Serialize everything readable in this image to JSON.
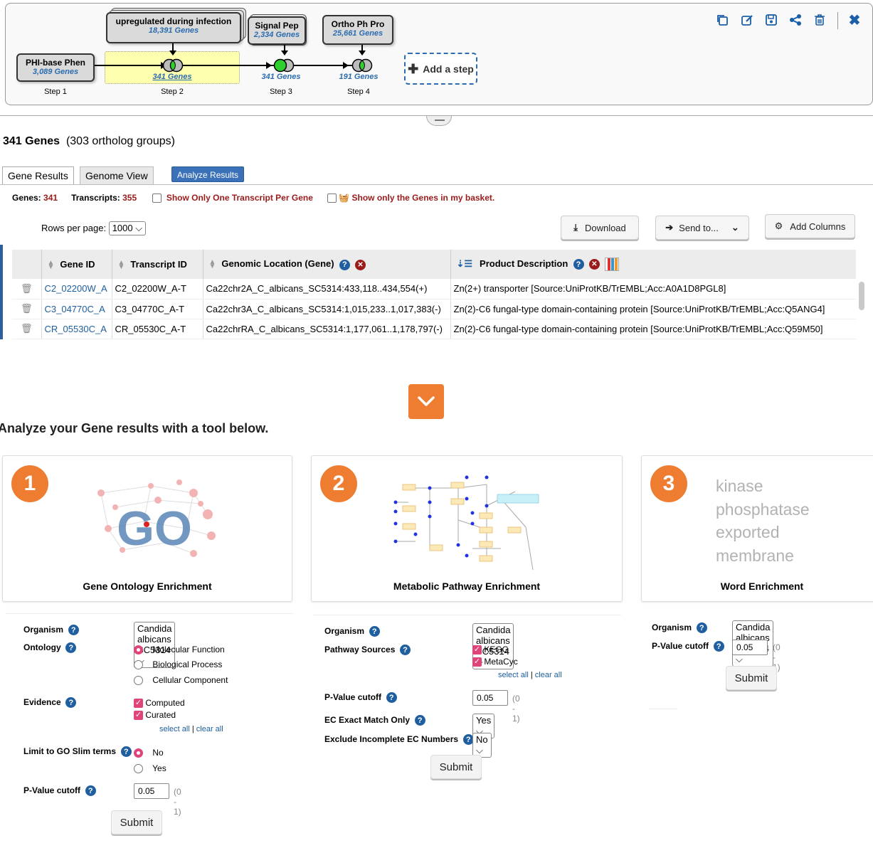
{
  "strategy": {
    "steps": [
      {
        "name": "PHI-base Phen",
        "count": "3,089 Genes",
        "label": "Step 1"
      },
      {
        "name": "upregulated during infection",
        "count": "18,391 Genes",
        "result": "341 Genes",
        "label": "Step 2"
      },
      {
        "name": "Signal Pep",
        "count": "2,334 Genes",
        "result": "341 Genes",
        "label": "Step 3"
      },
      {
        "name": "Ortho Ph Pro",
        "count": "25,661 Genes",
        "result": "191 Genes",
        "label": "Step 4"
      }
    ],
    "add_step": "Add a step",
    "toolbar": [
      "copy-icon",
      "edit-icon",
      "save-icon",
      "share-icon",
      "delete-icon",
      "close-icon"
    ]
  },
  "results": {
    "count": "341 Genes",
    "groups": "(303 ortholog groups)",
    "tabs": [
      "Gene Results",
      "Genome View",
      "Analyze Results"
    ],
    "genes_label": "Genes:",
    "genes_value": "341",
    "transcripts_label": "Transcripts:",
    "transcripts_value": "355",
    "one_transcript": "Show Only One Transcript Per Gene",
    "basket_only": "Show only the Genes in my basket.",
    "rows_label": "Rows per page:",
    "rows_value": "1000",
    "download": "Download",
    "send_to": "Send to...",
    "add_columns": "Add Columns",
    "columns": [
      "Gene ID",
      "Transcript ID",
      "Genomic Location (Gene)",
      "Product Description"
    ],
    "rows": [
      {
        "gene": "C2_02200W_A",
        "transcript": "C2_02200W_A-T",
        "location": "Ca22chr2A_C_albicans_SC5314:433,118..434,554(+)",
        "product": "Zn(2+) transporter [Source:UniProtKB/TrEMBL;Acc:A0A1D8PGL8]"
      },
      {
        "gene": "C3_04770C_A",
        "transcript": "C3_04770C_A-T",
        "location": "Ca22chr3A_C_albicans_SC5314:1,015,233..1,017,383(-)",
        "product": "Zn(2)-C6 fungal-type domain-containing protein [Source:UniProtKB/TrEMBL;Acc:Q5ANG4]"
      },
      {
        "gene": "CR_05530C_A",
        "transcript": "CR_05530C_A-T",
        "location": "Ca22chrRA_C_albicans_SC5314:1,177,061..1,178,797(-)",
        "product": "Zn(2)-C6 fungal-type domain-containing protein [Source:UniProtKB/TrEMBL;Acc:Q59M50]"
      }
    ]
  },
  "analyze": {
    "heading": "Analyze your Gene results with a tool below.",
    "cards": [
      {
        "num": "1",
        "title": "Gene Ontology Enrichment",
        "image_text": "GO"
      },
      {
        "num": "2",
        "title": "Metabolic Pathway Enrichment"
      },
      {
        "num": "3",
        "title": "Word Enrichment",
        "words": [
          "kinase",
          "phosphatase",
          "exported",
          "membrane"
        ]
      }
    ],
    "go_form": {
      "organism_label": "Organism",
      "organism_value": "Candida albicans SC5314",
      "ontology_label": "Ontology",
      "ontology_options": [
        "Molecular Function",
        "Biological Process",
        "Cellular Component"
      ],
      "evidence_label": "Evidence",
      "evidence_options": [
        "Computed",
        "Curated"
      ],
      "select_all": "select all",
      "clear_all": "clear all",
      "slim_label": "Limit to GO Slim terms",
      "slim_options": [
        "No",
        "Yes"
      ],
      "pvalue_label": "P-Value cutoff",
      "pvalue_value": "0.05",
      "pvalue_range": "(0 - 1)",
      "submit": "Submit"
    },
    "pathway_form": {
      "organism_label": "Organism",
      "organism_value": "Candida albicans SC5314",
      "sources_label": "Pathway Sources",
      "sources_options": [
        "KEGG",
        "MetaCyc"
      ],
      "select_all": "select all",
      "clear_all": "clear all",
      "pvalue_label": "P-Value cutoff",
      "pvalue_value": "0.05",
      "pvalue_range": "(0 - 1)",
      "ec_label": "EC Exact Match Only",
      "ec_value": "Yes",
      "exclude_label": "Exclude Incomplete EC Numbers",
      "exclude_value": "No",
      "submit": "Submit"
    },
    "word_form": {
      "organism_label": "Organism",
      "organism_value": "Candida albicans SC5314",
      "pvalue_label": "P-Value cutoff",
      "pvalue_value": "0.05",
      "pvalue_range": "(0 - 1)",
      "submit": "Submit"
    }
  }
}
